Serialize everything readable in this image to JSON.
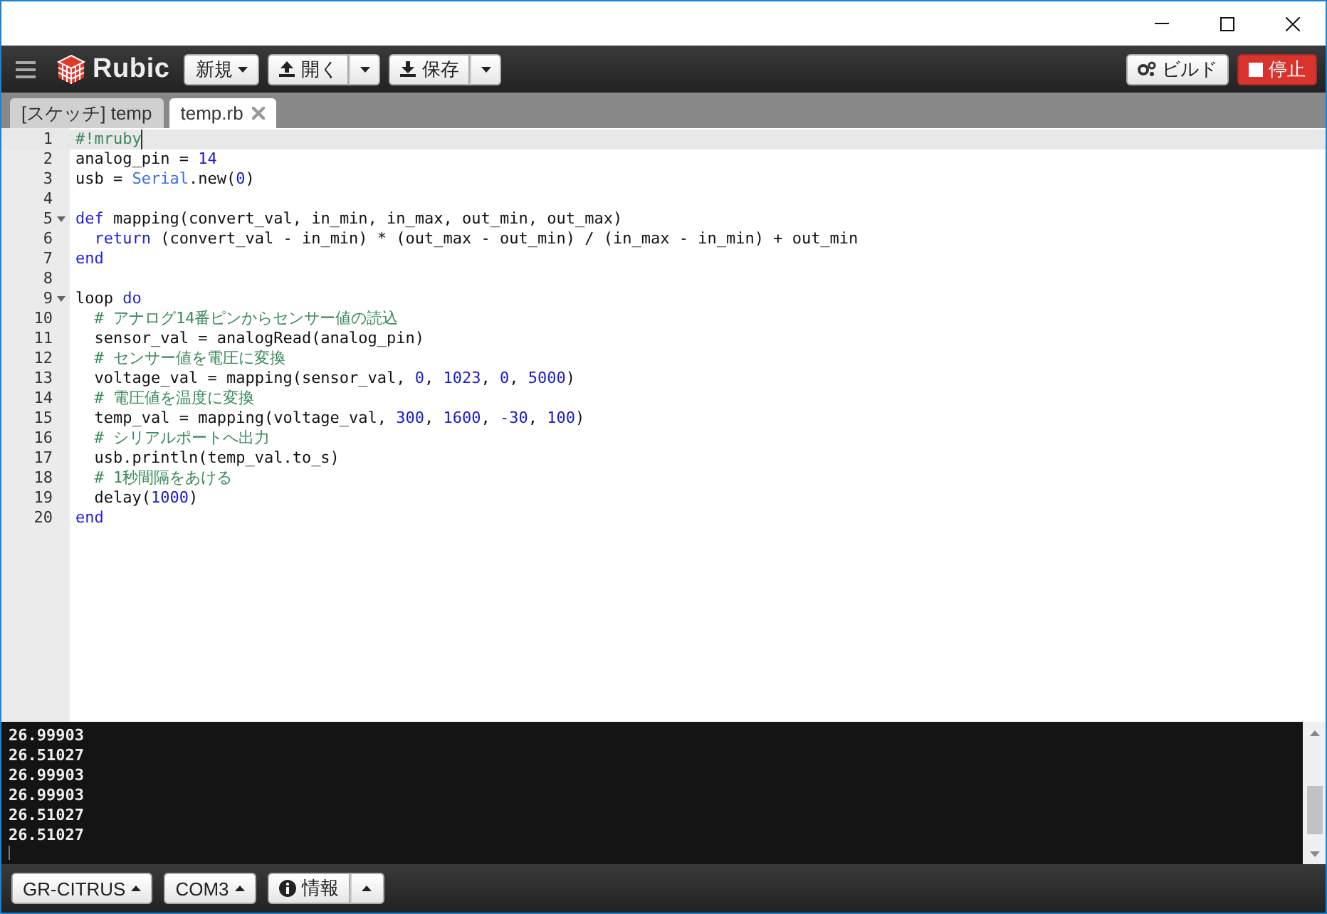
{
  "toolbar": {
    "app_name": "Rubic",
    "buttons": [
      {
        "label": "新規",
        "split": false
      },
      {
        "label": "開く",
        "split": true
      },
      {
        "label": "保存",
        "split": true
      }
    ],
    "build": "ビルド",
    "stop": "停止"
  },
  "tabs": [
    {
      "label": "[スケッチ] temp",
      "selected": false,
      "closable": false
    },
    {
      "label": "temp.rb",
      "selected": true,
      "closable": true
    }
  ],
  "code": [
    {
      "number": "1",
      "fold": false,
      "selected": true,
      "tokens": [
        {
          "kind": "comment",
          "text": "#!mruby"
        }
      ]
    },
    {
      "number": "2",
      "fold": false,
      "selected": false,
      "tokens": [
        {
          "kind": "plain",
          "text": "analog_pin = "
        },
        {
          "kind": "number",
          "text": "14"
        }
      ]
    },
    {
      "number": "3",
      "fold": false,
      "selected": false,
      "tokens": [
        {
          "kind": "plain",
          "text": "usb = "
        },
        {
          "kind": "class",
          "text": "Serial"
        },
        {
          "kind": "plain",
          "text": ".new("
        },
        {
          "kind": "number",
          "text": "0"
        },
        {
          "kind": "plain",
          "text": ")"
        }
      ]
    },
    {
      "number": "4",
      "fold": false,
      "selected": false
    },
    {
      "number": "5",
      "fold": true,
      "selected": false,
      "tokens": [
        {
          "kind": "keyword",
          "text": "def"
        },
        {
          "kind": "plain",
          "text": " mapping(convert_val, in_min, in_max, out_min, out_max)"
        }
      ]
    },
    {
      "number": "6",
      "fold": false,
      "selected": false,
      "tokens": [
        {
          "kind": "keyword",
          "text": "  return"
        },
        {
          "kind": "plain",
          "text": " (convert_val - in_min) * (out_max - out_min) / (in_max - in_min) + out_min"
        }
      ]
    },
    {
      "number": "7",
      "fold": false,
      "selected": false,
      "tokens": [
        {
          "kind": "keyword",
          "text": "end"
        }
      ]
    },
    {
      "number": "8",
      "fold": false,
      "selected": false
    },
    {
      "number": "9",
      "fold": true,
      "selected": false,
      "tokens": [
        {
          "kind": "plain",
          "text": "loop "
        },
        {
          "kind": "keyword",
          "text": "do"
        }
      ]
    },
    {
      "number": "10",
      "fold": false,
      "selected": false,
      "tokens": [
        {
          "kind": "comment",
          "text": "  # アナログ14番ピンからセンサー値の読込"
        }
      ]
    },
    {
      "number": "11",
      "fold": false,
      "selected": false,
      "tokens": [
        {
          "kind": "plain",
          "text": "  sensor_val = analogRead(analog_pin)"
        }
      ]
    },
    {
      "number": "12",
      "fold": false,
      "selected": false,
      "tokens": [
        {
          "kind": "comment",
          "text": "  # センサー値を電圧に変換"
        }
      ]
    },
    {
      "number": "13",
      "fold": false,
      "selected": false,
      "tokens": [
        {
          "kind": "plain",
          "text": "  voltage_val = mapping(sensor_val, "
        },
        {
          "kind": "number",
          "text": "0"
        },
        {
          "kind": "plain",
          "text": ", "
        },
        {
          "kind": "number",
          "text": "1023"
        },
        {
          "kind": "plain",
          "text": ", "
        },
        {
          "kind": "number",
          "text": "0"
        },
        {
          "kind": "plain",
          "text": ", "
        },
        {
          "kind": "number",
          "text": "5000"
        },
        {
          "kind": "plain",
          "text": ")"
        }
      ]
    },
    {
      "number": "14",
      "fold": false,
      "selected": false,
      "tokens": [
        {
          "kind": "comment",
          "text": "  # 電圧値を温度に変換"
        }
      ]
    },
    {
      "number": "15",
      "fold": false,
      "selected": false,
      "tokens": [
        {
          "kind": "plain",
          "text": "  temp_val = mapping(voltage_val, "
        },
        {
          "kind": "number",
          "text": "300"
        },
        {
          "kind": "plain",
          "text": ", "
        },
        {
          "kind": "number",
          "text": "1600"
        },
        {
          "kind": "plain",
          "text": ", "
        },
        {
          "kind": "number",
          "text": "-30"
        },
        {
          "kind": "plain",
          "text": ", "
        },
        {
          "kind": "number",
          "text": "100"
        },
        {
          "kind": "plain",
          "text": ")"
        }
      ]
    },
    {
      "number": "16",
      "fold": false,
      "selected": false,
      "tokens": [
        {
          "kind": "comment",
          "text": "  # シリアルポートへ出力"
        }
      ]
    },
    {
      "number": "17",
      "fold": false,
      "selected": false,
      "tokens": [
        {
          "kind": "plain",
          "text": "  usb.println(temp_val.to_s)"
        }
      ]
    },
    {
      "number": "18",
      "fold": false,
      "selected": false,
      "tokens": [
        {
          "kind": "comment",
          "text": "  # 1秒間隔をあける"
        }
      ]
    },
    {
      "number": "19",
      "fold": false,
      "selected": false,
      "tokens": [
        {
          "kind": "plain",
          "text": "  delay("
        },
        {
          "kind": "number",
          "text": "1000"
        },
        {
          "kind": "plain",
          "text": ")"
        }
      ]
    },
    {
      "number": "20",
      "fold": false,
      "selected": false,
      "tokens": [
        {
          "kind": "keyword",
          "text": "end"
        }
      ]
    }
  ],
  "console": [
    "26.99903",
    "26.51027",
    "26.99903",
    "26.99903",
    "26.51027",
    "26.51027"
  ],
  "status_bar": {
    "board": "GR-CITRUS",
    "port": "COM3",
    "info": "情報"
  }
}
